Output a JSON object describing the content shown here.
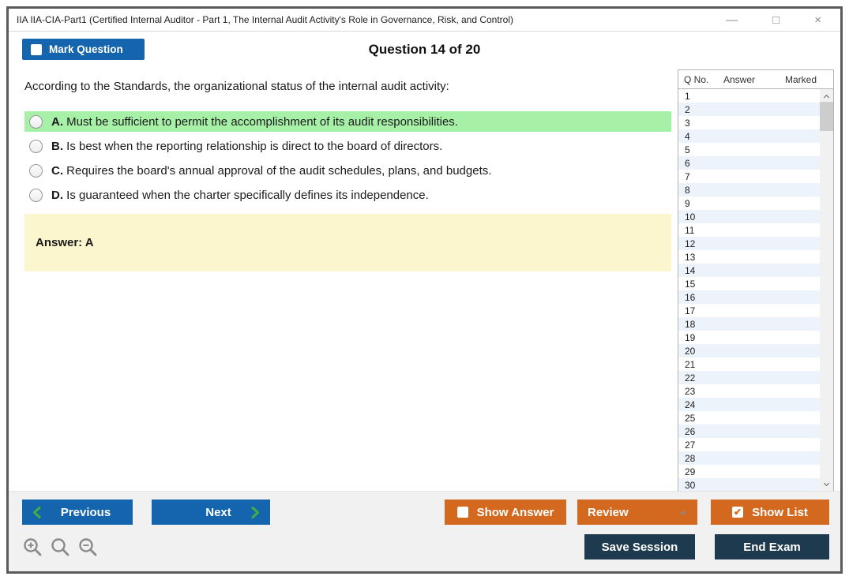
{
  "window": {
    "title": "IIA IIA-CIA-Part1 (Certified Internal Auditor - Part 1, The Internal Audit Activity's Role in Governance, Risk, and Control)",
    "controls": {
      "minimize": "—",
      "maximize": "□",
      "close": "×"
    }
  },
  "header": {
    "mark_question_label": "Mark Question",
    "mark_question_checkbox": "unchecked",
    "question_counter": "Question 14 of 20"
  },
  "question": {
    "text": "According to the Standards, the organizational status of the internal audit activity:",
    "options": [
      {
        "letter": "A.",
        "text": "Must be sufficient to permit the accomplishment of its audit responsibilities.",
        "highlighted": true
      },
      {
        "letter": "B.",
        "text": "Is best when the reporting relationship is direct to the board of directors.",
        "highlighted": false
      },
      {
        "letter": "C.",
        "text": "Requires the board's annual approval of the audit schedules, plans, and budgets.",
        "highlighted": false
      },
      {
        "letter": "D.",
        "text": "Is guaranteed when the charter specifically defines its independence.",
        "highlighted": false
      }
    ],
    "answer_label": "Answer: A"
  },
  "question_list": {
    "columns": [
      "Q No.",
      "Answer",
      "Marked"
    ],
    "visible_rows": [
      "1",
      "2",
      "3",
      "4",
      "5",
      "6",
      "7",
      "8",
      "9",
      "10",
      "11",
      "12",
      "13",
      "14",
      "15",
      "16",
      "17",
      "18",
      "19",
      "20",
      "21",
      "22",
      "23",
      "24",
      "25",
      "26",
      "27",
      "28",
      "29",
      "30"
    ]
  },
  "footer": {
    "previous_label": "Previous",
    "next_label": "Next",
    "show_answer_label": "Show Answer",
    "show_answer_checkbox": "unchecked",
    "review_label": "Review",
    "show_list_label": "Show List",
    "show_list_checkbox": "checked",
    "save_session_label": "Save Session",
    "end_exam_label": "End Exam"
  },
  "icons": {
    "checkmark_glyph": "✔",
    "review_dropdown_glyph": "▲",
    "zoom_icon_names": [
      "zoom-in-icon",
      "zoom-icon",
      "zoom-out-icon"
    ]
  },
  "colors": {
    "accent_blue": "#1565AE",
    "accent_orange": "#D2691E",
    "dark_navy": "#1D3A4E",
    "highlight_green": "#A7F0A7",
    "answer_yellow": "#FBF6CD",
    "list_alt_row": "#EDF3FA",
    "footer_bg": "#F1F1F1",
    "chevron_green": "#3CB043"
  }
}
